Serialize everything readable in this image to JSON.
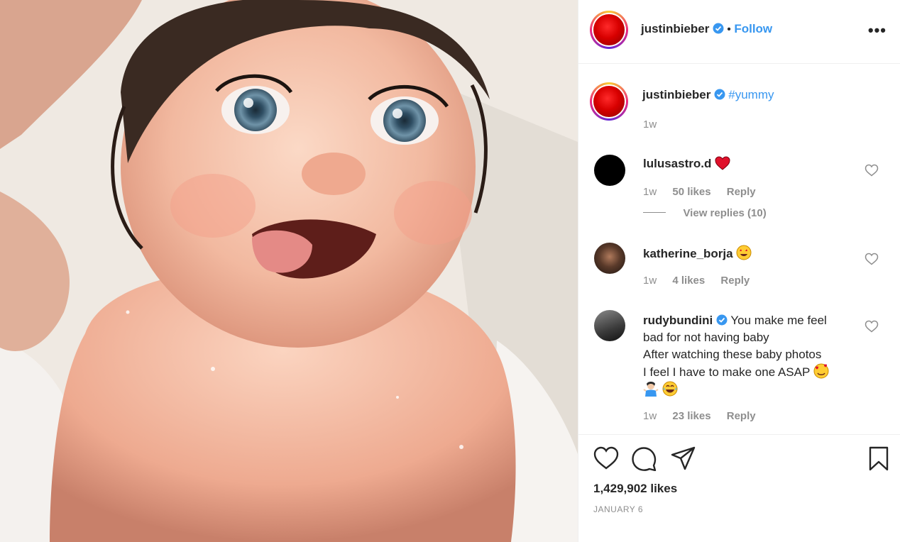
{
  "post": {
    "username": "justinbieber",
    "follow_label": "Follow",
    "more_label": "•••",
    "caption_tag": "#yummy",
    "caption_time": "1w",
    "likes": "1,429,902 likes",
    "date": "JANUARY 6"
  },
  "comments": [
    {
      "username": "lulusastro.d",
      "text": "",
      "time": "1w",
      "likes": "50 likes",
      "reply": "Reply",
      "view_replies": "View replies (10)",
      "emoji": "red-heart"
    },
    {
      "username": "katherine_borja",
      "text": "",
      "time": "1w",
      "likes": "4 likes",
      "reply": "Reply",
      "emoji": "star-struck"
    },
    {
      "username": "rudybundini",
      "line1": "You make me feel",
      "line2": "bad for not having baby",
      "line3": "After watching these baby photos",
      "line4": "I feel I have to make one ASAP",
      "time": "1w",
      "likes": "23 likes",
      "reply": "Reply",
      "emoji": "smiling-face-hearts, shrug, tears-of-joy"
    }
  ],
  "colors": {
    "link": "#3897f0",
    "verified": "#3897f0",
    "text": "#262626",
    "muted": "#8e8e8e"
  },
  "icons": [
    "heart-icon",
    "comment-icon",
    "share-icon",
    "bookmark-icon",
    "verified-icon",
    "more-icon"
  ]
}
